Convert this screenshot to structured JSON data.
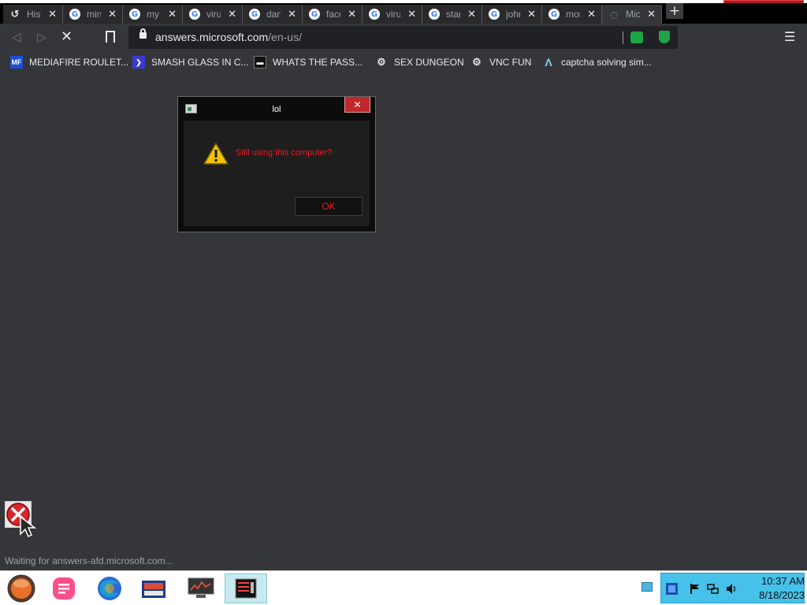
{
  "browser": {
    "tabs": [
      {
        "icon": "history-icon",
        "label": "Hist"
      },
      {
        "icon": "google-icon",
        "label": "min"
      },
      {
        "icon": "google-icon",
        "label": "my"
      },
      {
        "icon": "google-icon",
        "label": "viru"
      },
      {
        "icon": "google-icon",
        "label": "dan"
      },
      {
        "icon": "google-icon",
        "label": "face"
      },
      {
        "icon": "google-icon",
        "label": "viru"
      },
      {
        "icon": "google-icon",
        "label": "star"
      },
      {
        "icon": "google-icon",
        "label": "john"
      },
      {
        "icon": "google-icon",
        "label": "mor"
      },
      {
        "icon": "microsoft-loading-icon",
        "label": "Mic",
        "active": true
      }
    ],
    "url": {
      "host": "answers.microsoft.com",
      "path": "/en-us/"
    },
    "bookmarks": [
      {
        "icon": "mediafire-icon",
        "label": "MEDIAFIRE ROULET...",
        "color": "#1c4fd6"
      },
      {
        "icon": "powershell-icon",
        "label": "SMASH GLASS IN C...",
        "color": "#3a3ad0"
      },
      {
        "icon": "terminal-icon",
        "label": "WHATS THE PASS...",
        "color": "#111111"
      },
      {
        "icon": "chip-icon",
        "label": "SEX DUNGEON",
        "color": "#cccccc"
      },
      {
        "icon": "chip-icon",
        "label": "VNC FUN",
        "color": "#cccccc"
      },
      {
        "icon": "arch-icon",
        "label": "captcha solving sim...",
        "color": "#7fd4e8"
      }
    ],
    "status_text": "Waiting for answers-afd.microsoft.com..."
  },
  "dialog": {
    "title": "lol",
    "close_label": "✕",
    "message": "Still using this computer?",
    "ok_label": "OK",
    "message_color": "#e81c22"
  },
  "taskbar": {
    "apps": [
      {
        "name": "start-orb"
      },
      {
        "name": "app-pink-notes"
      },
      {
        "name": "firefox"
      },
      {
        "name": "app-files"
      },
      {
        "name": "app-monitor"
      },
      {
        "name": "app-window-selected",
        "selected": true
      }
    ],
    "clock": {
      "time": "10:37 AM",
      "date": "8/18/2023"
    }
  },
  "colors": {
    "page_bg": "#35363a",
    "tabbar_bg": "#000000",
    "tray_bg": "#46c2ea",
    "accent_red": "#c0282c"
  }
}
